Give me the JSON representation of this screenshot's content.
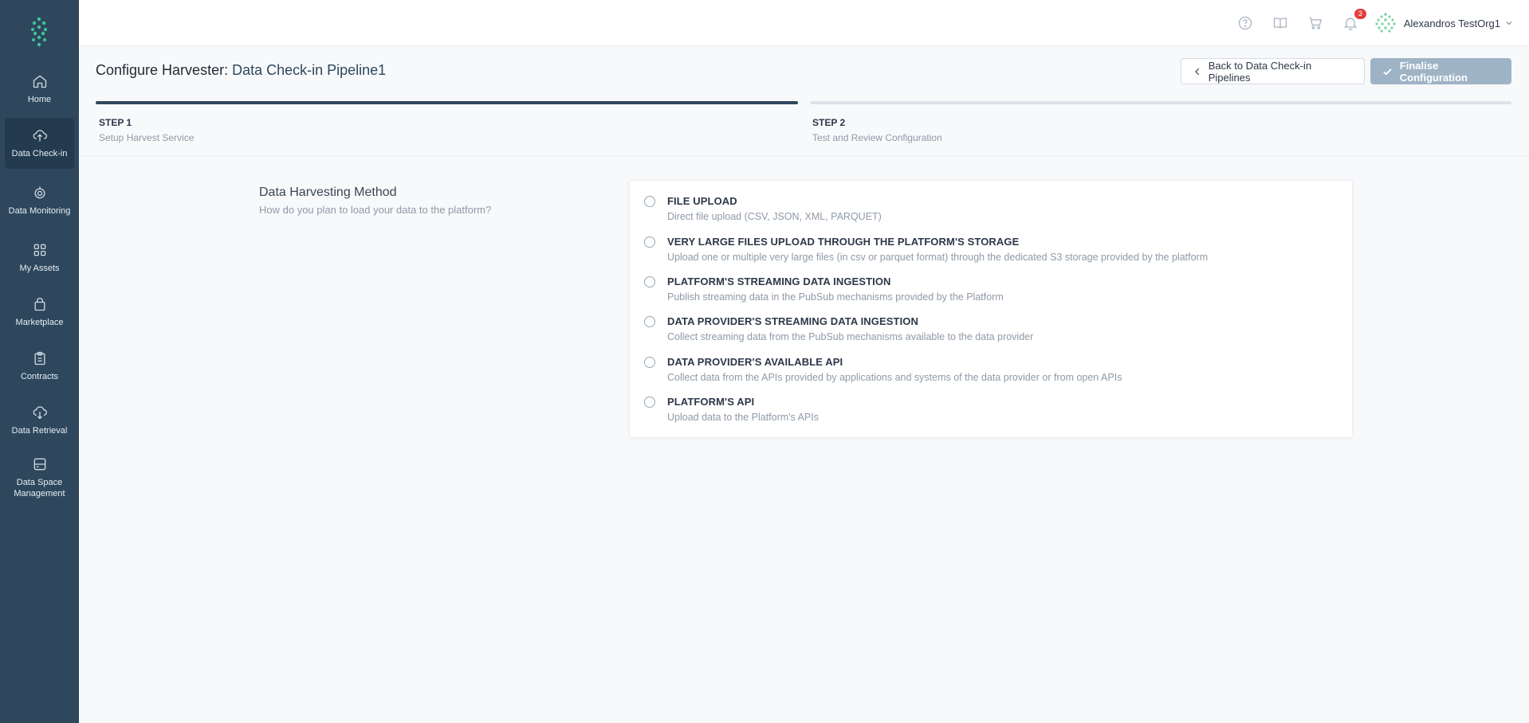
{
  "sidebar": {
    "items": [
      {
        "label": "Home",
        "icon": "home-icon"
      },
      {
        "label": "Data Check-in",
        "icon": "upload-cloud-icon"
      },
      {
        "label": "Data Monitoring",
        "icon": "monitoring-icon"
      },
      {
        "label": "My Assets",
        "icon": "grid-icon"
      },
      {
        "label": "Marketplace",
        "icon": "shopping-bag-icon"
      },
      {
        "label": "Contracts",
        "icon": "clipboard-icon"
      },
      {
        "label": "Data Retrieval",
        "icon": "download-cloud-icon"
      },
      {
        "label": "Data Space Management",
        "icon": "storage-icon"
      }
    ]
  },
  "topbar": {
    "notification_count": "3",
    "user_name": "Alexandros TestOrg1"
  },
  "header": {
    "prefix": "Configure Harvester: ",
    "name": "Data Check-in Pipeline1",
    "back_label": "Back to Data Check-in Pipelines",
    "finalise_label": "Finalise Configuration"
  },
  "steps": [
    {
      "title": "STEP 1",
      "subtitle": "Setup Harvest Service"
    },
    {
      "title": "STEP 2",
      "subtitle": "Test and Review Configuration"
    }
  ],
  "method": {
    "title": "Data Harvesting Method",
    "subtitle": "How do you plan to load your data to the platform?",
    "options": [
      {
        "title": "FILE UPLOAD",
        "subtitle": "Direct file upload (CSV, JSON, XML, PARQUET)"
      },
      {
        "title": "VERY LARGE FILES UPLOAD THROUGH THE PLATFORM'S STORAGE",
        "subtitle": "Upload one or multiple very large files (in csv or parquet format) through the dedicated S3 storage provided by the platform"
      },
      {
        "title": "PLATFORM'S STREAMING DATA INGESTION",
        "subtitle": "Publish streaming data in the PubSub mechanisms provided by the Platform"
      },
      {
        "title": "DATA PROVIDER'S STREAMING DATA INGESTION",
        "subtitle": "Collect streaming data from the PubSub mechanisms available to the data provider"
      },
      {
        "title": "DATA PROVIDER'S AVAILABLE API",
        "subtitle": "Collect data from the APIs provided by applications and systems of the data provider or from open APIs"
      },
      {
        "title": "PLATFORM'S API",
        "subtitle": "Upload data to the Platform's APIs"
      }
    ]
  },
  "colors": {
    "sidebar": "#2e475d",
    "accent": "#2e475d",
    "disabled_button": "#9fb3c6",
    "badge": "#e53e3e"
  }
}
